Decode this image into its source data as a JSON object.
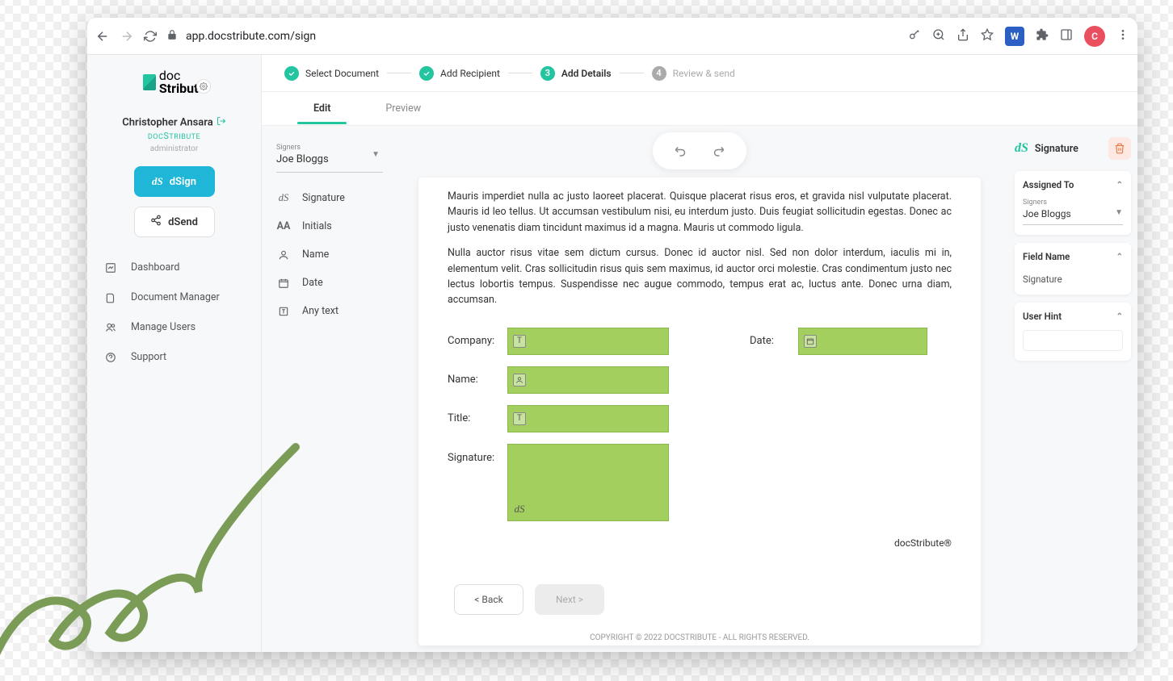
{
  "browser": {
    "url_host": "app.docstribute.com",
    "url_path": "/sign"
  },
  "brand": {
    "line1": "doc",
    "line2": "Stribute"
  },
  "user": {
    "name": "Christopher Ansara",
    "org": "docStribute",
    "role": "administrator"
  },
  "sidebar_buttons": {
    "primary": "dSign",
    "secondary": "dSend"
  },
  "nav": [
    {
      "label": "Dashboard"
    },
    {
      "label": "Document Manager"
    },
    {
      "label": "Manage Users"
    },
    {
      "label": "Support"
    }
  ],
  "steps": [
    {
      "num": "✓",
      "label": "Select Document",
      "state": "done"
    },
    {
      "num": "✓",
      "label": "Add Recipient",
      "state": "done"
    },
    {
      "num": "3",
      "label": "Add Details",
      "state": "active"
    },
    {
      "num": "4",
      "label": "Review & send",
      "state": "pending"
    }
  ],
  "tabs": {
    "edit": "Edit",
    "preview": "Preview"
  },
  "signer_dropdown": {
    "label": "Signers",
    "value": "Joe Bloggs"
  },
  "palette": [
    {
      "label": "Signature"
    },
    {
      "label": "Initials"
    },
    {
      "label": "Name"
    },
    {
      "label": "Date"
    },
    {
      "label": "Any text"
    }
  ],
  "doc": {
    "para1": "Mauris imperdiet nulla ac justo laoreet placerat. Quisque placerat risus eros, et gravida nisl vulputate placerat. Mauris id leo tellus. Ut accumsan vestibulum nisi, eu interdum justo. Duis feugiat sollicitudin egestas. Donec ac justo venenatis diam tincidunt maximus id a magna. Mauris ut commodo ligula.",
    "para2": "Nulla auctor risus vitae sem dictum cursus. Donec id auctor nisl. Sed non dolor interdum, iaculis mi in, elementum velit. Cras sollicitudin risus quis sem maximus, id auctor orci molestie. Cras condimentum justo nec lectus lobortis tempus. Suspendisse nec augue commodo, tempus erat ac, luctus ante. Donec urna diam, accumsan.",
    "labels": {
      "company": "Company:",
      "date": "Date:",
      "name": "Name:",
      "title": "Title:",
      "signature": "Signature:"
    },
    "footer": "docStribute®"
  },
  "right_panel": {
    "title": "Signature",
    "assigned_to": "Assigned To",
    "signer_label": "Signers",
    "signer_value": "Joe Bloggs",
    "field_name_label": "Field Name",
    "field_name_value": "Signature",
    "user_hint_label": "User Hint"
  },
  "bottom": {
    "back": "< Back",
    "next": "Next >"
  },
  "copyright": "COPYRIGHT © 2022 DOCSTRIBUTE - ALL RIGHTS RESERVED."
}
